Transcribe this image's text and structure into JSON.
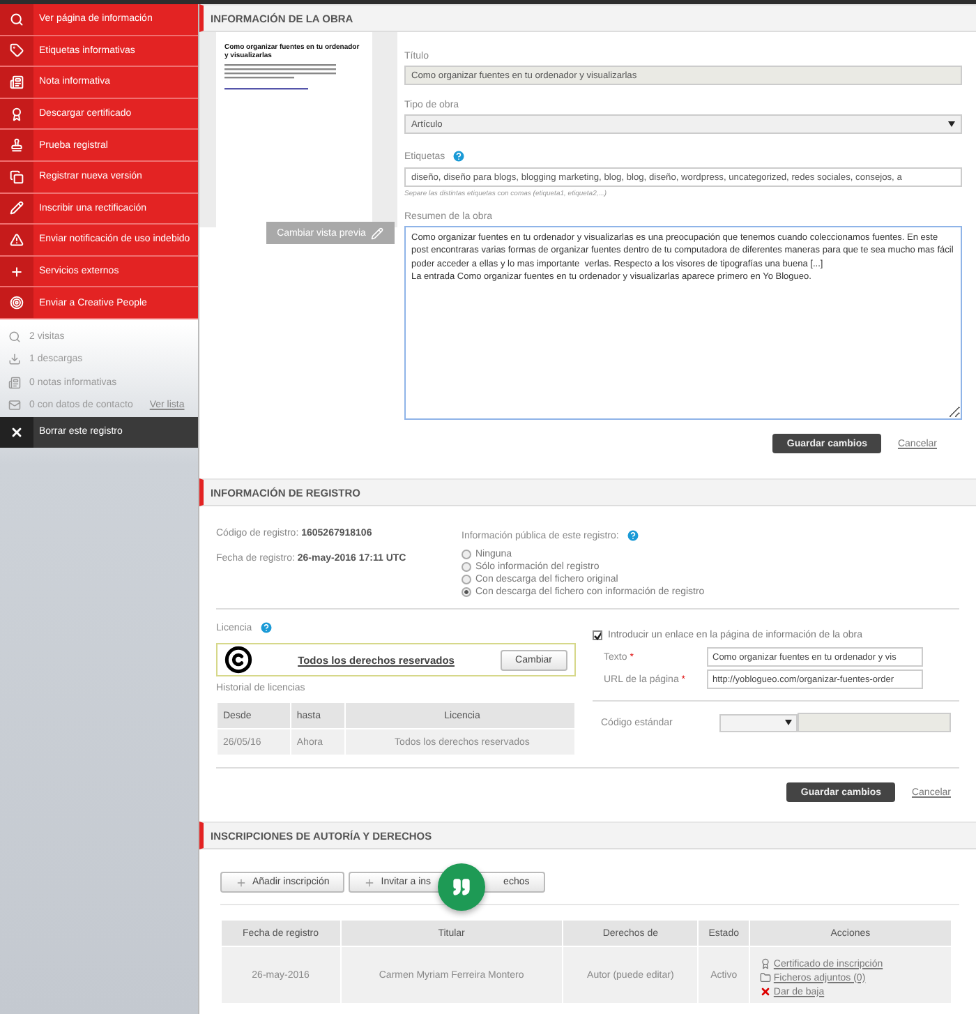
{
  "sidebar": {
    "actions": [
      {
        "kind": "search",
        "label": "Ver página de información"
      },
      {
        "kind": "tag",
        "label": "Etiquetas informativas"
      },
      {
        "kind": "note",
        "label": "Nota informativa"
      },
      {
        "kind": "award",
        "label": "Descargar certificado"
      },
      {
        "kind": "stamp",
        "label": "Prueba registral"
      },
      {
        "kind": "copy",
        "label": "Registrar nueva versión"
      },
      {
        "kind": "pencil",
        "label": "Inscribir una rectificación"
      },
      {
        "kind": "warning",
        "label": "Enviar notificación de uso indebido"
      },
      {
        "kind": "plus",
        "label": "Servicios externos"
      },
      {
        "kind": "target",
        "label": "Enviar a Creative People"
      }
    ],
    "stats": [
      {
        "kind": "search",
        "label": "2 visitas"
      },
      {
        "kind": "download",
        "label": "1 descargas"
      },
      {
        "kind": "note",
        "label": "0 notas informativas"
      },
      {
        "kind": "mail",
        "label": "0 con datos de contacto",
        "link": "Ver lista"
      }
    ],
    "delete_action": {
      "label": "Borrar este registro"
    }
  },
  "work_info": {
    "header": "INFORMACIÓN DE LA OBRA",
    "preview": {
      "title": "Como organizar fuentes en tu ordenador y visualizarlas",
      "change_button": "Cambiar vista previa"
    },
    "title_label": "Título",
    "title_value": "Como organizar fuentes en tu ordenador y visualizarlas",
    "type_label": "Tipo de obra",
    "type_value": "Artículo",
    "tags_label": "Etiquetas",
    "tags_value": "diseño, diseño para blogs, blogging marketing, blog, blog, diseño, wordpress, uncategorized, redes sociales, consejos, a",
    "tags_hint": "Separe las distintas etiquetas con comas (etiqueta1, etiqueta2,...)",
    "summary_label": "Resumen de la obra",
    "summary_value": "Como organizar fuentes en tu ordenador y visualizarlas es una preocupación que tenemos cuando coleccionamos fuentes. En este post encontraras varias formas de organizar fuentes dentro de tu computadora de diferentes maneras para que te sea mucho mas fácil poder acceder a ellas y lo mas importante  verlas. Respecto a los visores de tipografías una buena [...]\nLa entrada Como organizar fuentes en tu ordenador y visualizarlas aparece primero en Yo Blogueo.",
    "save": "Guardar cambios",
    "cancel": "Cancelar"
  },
  "registry_info": {
    "header": "INFORMACIÓN DE REGISTRO",
    "facts": [
      {
        "label": "Código de registro:",
        "value": "1605267918106"
      },
      {
        "label": "Fecha de registro:",
        "value": "26-may-2016 17:11 UTC"
      }
    ],
    "public_label": "Información pública de este registro:",
    "public_options": [
      {
        "label": "Ninguna",
        "selected": false
      },
      {
        "label": "Sólo información del registro",
        "selected": false
      },
      {
        "label": "Con descarga del fichero original",
        "selected": false
      },
      {
        "label": "Con descarga del fichero con información de registro",
        "selected": true
      }
    ],
    "license_label": "Licencia",
    "license_name": "Todos los derechos reservados",
    "license_change": "Cambiar",
    "history_label": "Historial de licencias",
    "history_columns": [
      "Desde",
      "hasta",
      "Licencia"
    ],
    "history_rows": [
      [
        "26/05/16",
        "Ahora",
        "Todos los derechos reservados"
      ]
    ],
    "link_checkbox": {
      "label": "Introducir un enlace en la página de información de la obra",
      "checked": true
    },
    "link_fields": [
      {
        "label": "Texto",
        "required_mark": "*",
        "value": "Como organizar fuentes en tu ordenador y vis"
      },
      {
        "label": "URL de la página",
        "required_mark": "*",
        "value": "http://yoblogueo.com/organizar-fuentes-order"
      }
    ],
    "standard_code_label": "Código estándar",
    "save": "Guardar cambios",
    "cancel": "Cancelar"
  },
  "inscriptions": {
    "header": "INSCRIPCIONES DE AUTORÍA Y DERECHOS",
    "add_button": "Añadir inscripción",
    "invite_button_start": "Invitar a ins",
    "invite_button_end": "echos",
    "columns": [
      "Fecha de registro",
      "Titular",
      "Derechos de",
      "Estado",
      "Acciones"
    ],
    "rows": [
      {
        "date": "26-may-2016",
        "holder": "Carmen Myriam Ferreira Montero",
        "rights": "Autor (puede editar)",
        "status": "Activo",
        "actions": [
          {
            "kind": "award",
            "label": "Certificado de inscripción"
          },
          {
            "kind": "folder",
            "label": "Ficheros adjuntos (0)"
          },
          {
            "kind": "remove",
            "label": "Dar de baja"
          }
        ]
      }
    ]
  }
}
